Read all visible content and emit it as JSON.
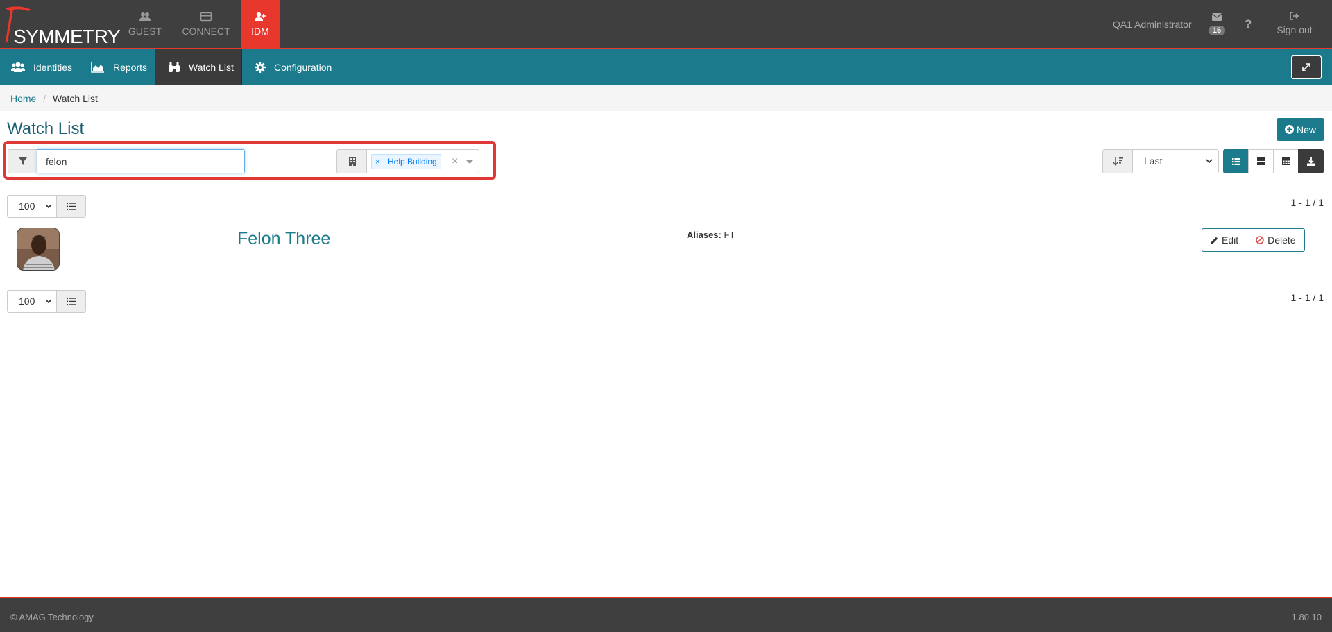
{
  "header": {
    "brand": "SYMMETRY",
    "brand_tm": "™",
    "apps": [
      {
        "label": "GUEST",
        "icon": "users-icon"
      },
      {
        "label": "CONNECT",
        "icon": "card-icon"
      },
      {
        "label": "IDM",
        "icon": "add-user-icon",
        "active": true
      }
    ],
    "user_name": "QA1 Administrator",
    "mail_count": "16",
    "help_label": "?",
    "signout_label": "Sign out"
  },
  "nav": {
    "items": [
      {
        "label": "Identities",
        "icon": "users-icon"
      },
      {
        "label": "Reports",
        "icon": "area-chart-icon"
      },
      {
        "label": "Watch List",
        "icon": "binoculars-icon",
        "active": true
      },
      {
        "label": "Configuration",
        "icon": "gear-icon"
      }
    ],
    "expand_icon": "expand-icon"
  },
  "breadcrumb": {
    "home": "Home",
    "separator": "/",
    "current": "Watch List"
  },
  "page": {
    "title": "Watch List",
    "new_label": "New"
  },
  "filter": {
    "search_value": "felon",
    "building_tag": "Help Building",
    "tag_remove": "×",
    "clear": "×"
  },
  "sort": {
    "selected": "Last"
  },
  "pager": {
    "page_size": "100",
    "count": "1 - 1 / 1"
  },
  "results": [
    {
      "name": "Felon Three",
      "aliases_label": "Aliases:",
      "aliases_value": "FT"
    }
  ],
  "actions": {
    "edit": "Edit",
    "delete": "Delete"
  },
  "footer": {
    "copyright": "© AMAG Technology",
    "version": "1.80.10"
  },
  "colors": {
    "primary": "#1b7b8c",
    "accent": "#e8372c",
    "dark": "#3f3f3f",
    "highlight": "#e03737"
  }
}
